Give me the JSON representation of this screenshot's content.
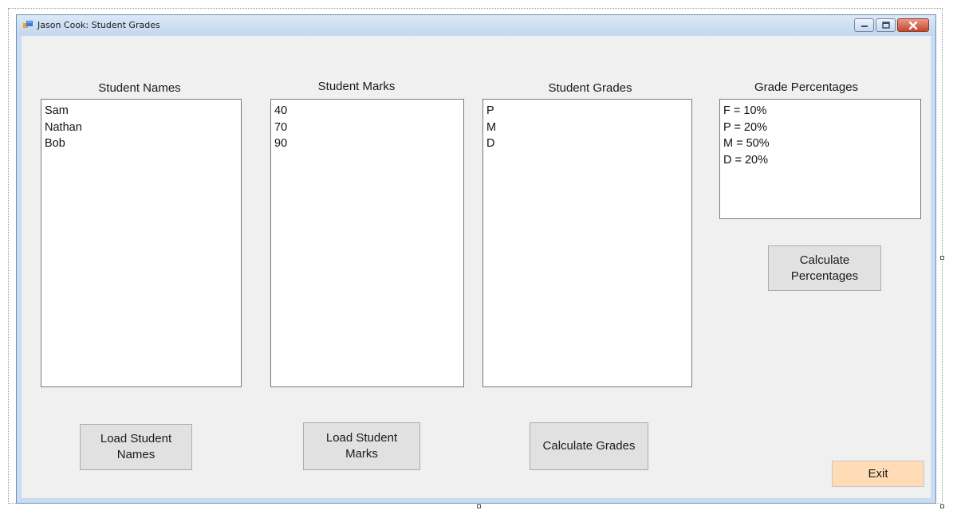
{
  "window": {
    "title": "Jason Cook: Student Grades"
  },
  "labels": {
    "names": "Student Names",
    "marks": "Student Marks",
    "grades": "Student Grades",
    "percentages": "Grade Percentages"
  },
  "lists": {
    "names": [
      "Sam",
      "Nathan",
      "Bob"
    ],
    "marks": [
      "40",
      "70",
      "90"
    ],
    "grades": [
      "P",
      "M",
      "D"
    ],
    "percentages": [
      "F = 10%",
      "P = 20%",
      "M = 50%",
      "D = 20%"
    ]
  },
  "buttons": {
    "load_names": "Load Student Names",
    "load_marks": "Load Student Marks",
    "calc_grades": "Calculate Grades",
    "calc_percentages": "Calculate Percentages",
    "exit": "Exit"
  },
  "colors": {
    "exit_button": "#ffdcb5",
    "form_background": "#f0f0f0",
    "close_button": "#c8452c"
  },
  "icons": {
    "app": "windows-form-icon",
    "minimize": "minimize-icon",
    "maximize": "maximize-icon",
    "close": "close-icon"
  }
}
